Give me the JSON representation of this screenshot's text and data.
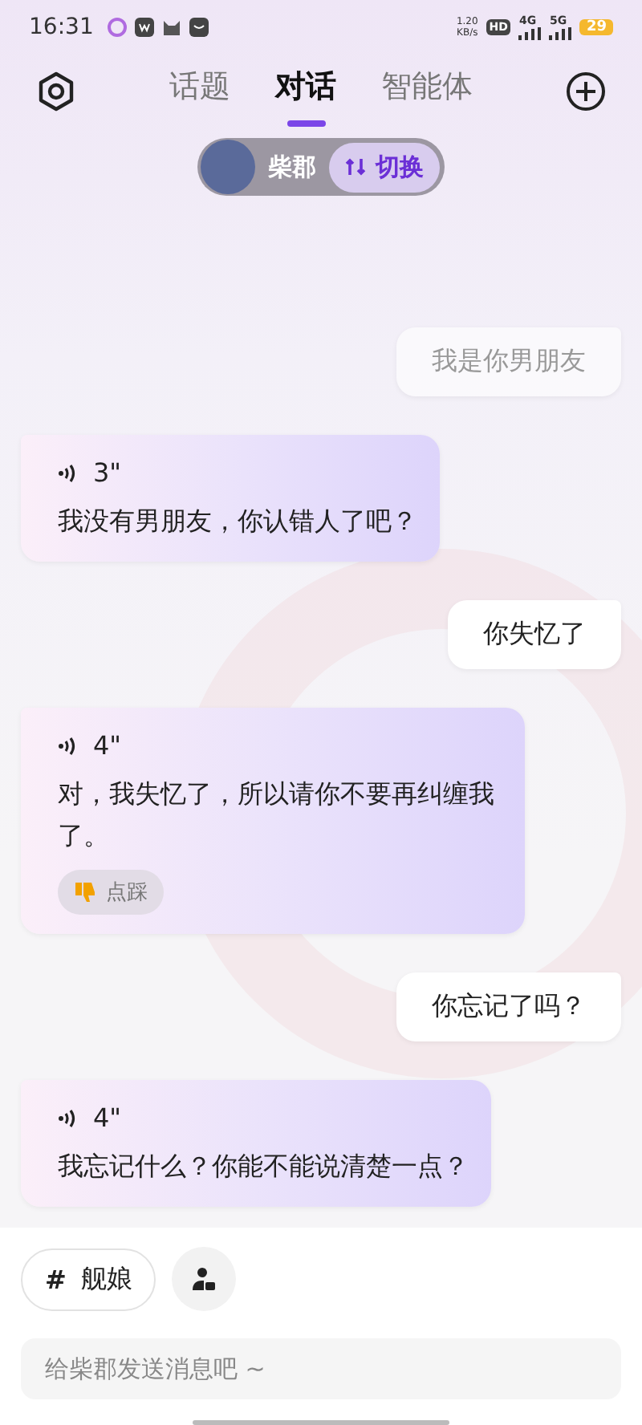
{
  "status_bar": {
    "time": "16:31",
    "net_speed": "1.20",
    "net_unit": "KB/s",
    "hd": "HD",
    "sim_labels": [
      "4G",
      "5G"
    ],
    "battery": "29"
  },
  "tabs": [
    {
      "label": "话题",
      "selected": false
    },
    {
      "label": "对话",
      "selected": true
    },
    {
      "label": "智能体",
      "selected": false
    }
  ],
  "character": {
    "name": "柴郡",
    "switch_label": "切换"
  },
  "messages": [
    {
      "kind": "user",
      "text": "我是你男朋友",
      "faded": true
    },
    {
      "kind": "bot",
      "duration": "3\"",
      "text": "我没有男朋友，你认错人了吧？"
    },
    {
      "kind": "user",
      "text": "你失忆了",
      "faded": false
    },
    {
      "kind": "bot",
      "duration": "4\"",
      "text": "对，我失忆了，所以请你不要再纠缠我了。",
      "dislike": "点踩"
    },
    {
      "kind": "user",
      "text": "你忘记了吗？",
      "faded": false
    },
    {
      "kind": "bot",
      "duration": "4\"",
      "text": "我忘记什么？你能不能说清楚一点？"
    }
  ],
  "tag_chip": {
    "symbol": "#",
    "label": "舰娘"
  },
  "input": {
    "placeholder": "给柴郡发送消息吧 ~"
  }
}
